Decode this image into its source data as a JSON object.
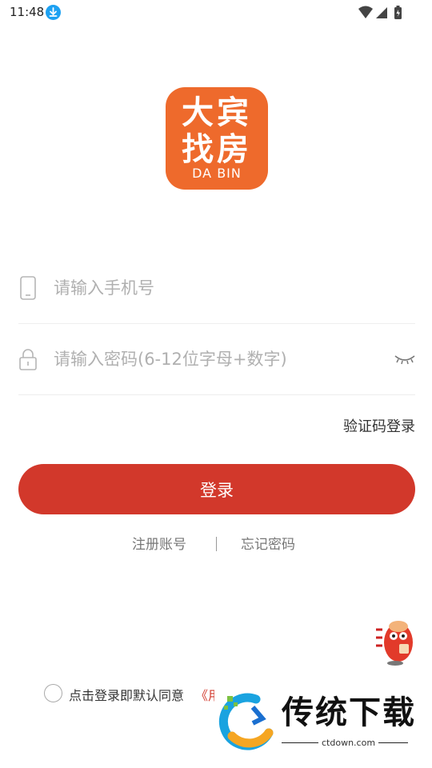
{
  "status_bar": {
    "time": "11:48"
  },
  "logo": {
    "line1": "大宾",
    "line2": "找房",
    "line3": "DA BIN"
  },
  "phone_field": {
    "placeholder": "请输入手机号"
  },
  "password_field": {
    "placeholder": "请输入密码(6-12位字母+数字)"
  },
  "sms_login_label": "验证码登录",
  "login_button_label": "登录",
  "links": {
    "register": "注册账号",
    "separator": "|",
    "forgot_password": "忘记密码"
  },
  "agreement": {
    "text": "点击登录即默认同意",
    "link": "《用"
  },
  "watermark": {
    "title": "传统下载",
    "url": "ctdown.com"
  },
  "colors": {
    "primary_red": "#d2382b",
    "logo_orange": "#ee6a2c",
    "placeholder_gray": "#b0b0b0"
  },
  "icons": [
    "download-icon",
    "wifi-icon",
    "signal-icon",
    "battery-icon",
    "phone-icon",
    "lock-icon",
    "eye-closed-icon",
    "mascot-icon"
  ]
}
